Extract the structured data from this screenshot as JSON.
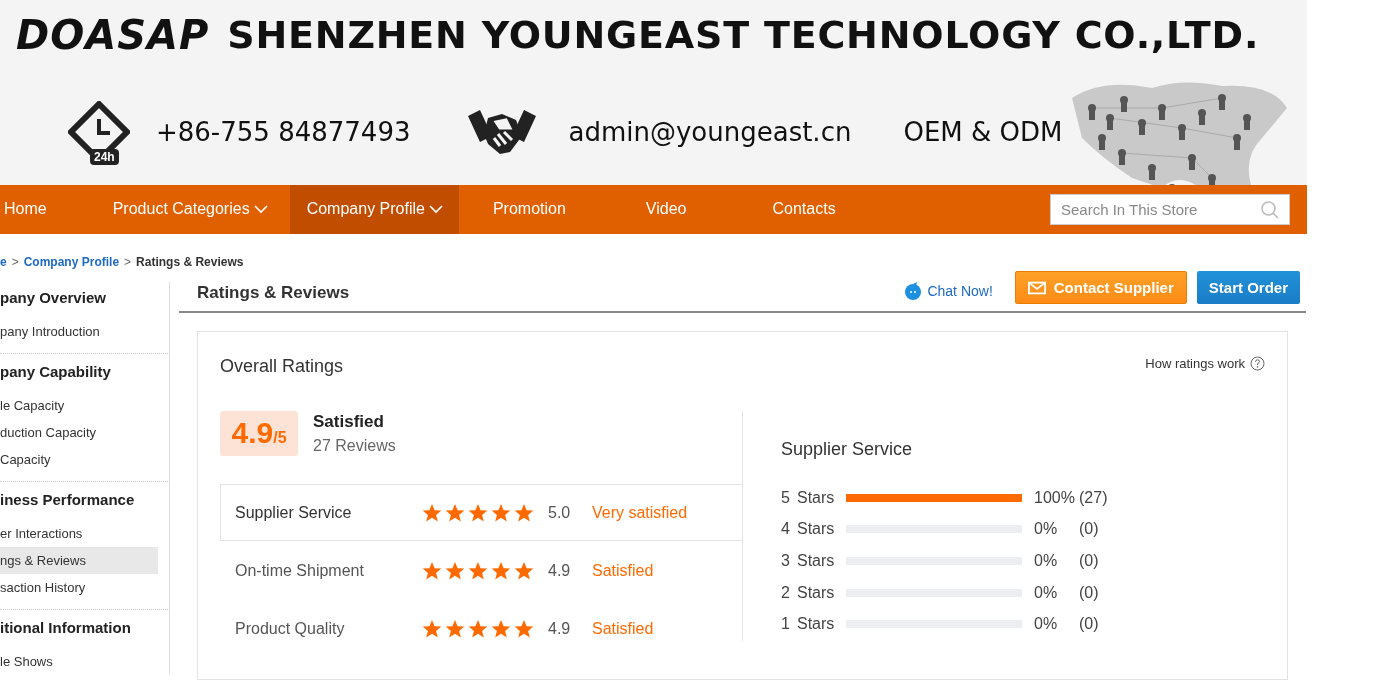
{
  "banner": {
    "logo": "DOASAP",
    "company_name": "SHENZHEN YOUNGEAST TECHNOLOGY CO.,LTD.",
    "clock_badge": "24h",
    "phone": "+86-755 84877493",
    "email": "admin@youngeast.cn",
    "tagline": "OEM & ODM"
  },
  "nav": {
    "items": [
      {
        "label": "Home",
        "dropdown": false,
        "selected": false
      },
      {
        "label": "Product Categories",
        "dropdown": true,
        "selected": false
      },
      {
        "label": "Company Profile",
        "dropdown": true,
        "selected": true
      },
      {
        "label": "Promotion",
        "dropdown": false,
        "selected": false
      },
      {
        "label": "Video",
        "dropdown": false,
        "selected": false
      },
      {
        "label": "Contacts",
        "dropdown": false,
        "selected": false
      }
    ],
    "search": {
      "placeholder": "Search In This Store"
    }
  },
  "breadcrumb": [
    {
      "label": "e",
      "kind": "link"
    },
    {
      "label": ">",
      "kind": "separator"
    },
    {
      "label": "Company Profile",
      "kind": "link"
    },
    {
      "label": ">",
      "kind": "separator"
    },
    {
      "label": "Ratings & Reviews",
      "kind": "current"
    }
  ],
  "sidebar": {
    "sections": [
      {
        "title": "pany Overview",
        "items": [
          {
            "label": "pany Introduction",
            "selected": false
          }
        ]
      },
      {
        "title": "pany Capability",
        "items": [
          {
            "label": "le Capacity",
            "selected": false
          },
          {
            "label": "duction Capacity",
            "selected": false
          },
          {
            "label": "Capacity",
            "selected": false
          }
        ]
      },
      {
        "title": "iness Performance",
        "items": [
          {
            "label": "er Interactions",
            "selected": false
          },
          {
            "label": "ngs & Reviews",
            "selected": true
          },
          {
            "label": "saction History",
            "selected": false
          }
        ]
      },
      {
        "title": "itional Information",
        "items": [
          {
            "label": "le Shows",
            "selected": false
          }
        ]
      }
    ]
  },
  "page_title": "Ratings & Reviews",
  "actions": {
    "chat": "Chat Now!",
    "contact": "Contact Supplier",
    "order": "Start Order"
  },
  "ratings": {
    "title": "Overall Ratings",
    "help": "How ratings work",
    "score": "4.9",
    "out_of": "/5",
    "verdict": "Satisfied",
    "reviews": "27 Reviews",
    "categories": [
      {
        "name": "Supplier Service",
        "stars": 5,
        "score": "5.0",
        "verdict": "Very satisfied",
        "selected": true
      },
      {
        "name": "On-time Shipment",
        "stars": 5,
        "score": "4.9",
        "verdict": "Satisfied",
        "selected": false
      },
      {
        "name": "Product Quality",
        "stars": 5,
        "score": "4.9",
        "verdict": "Satisfied",
        "selected": false
      }
    ],
    "breakdown": {
      "title": "Supplier Service",
      "rows": [
        {
          "stars_label": "5",
          "unit": "Stars",
          "level": 1,
          "percent": "100%",
          "count": "(27)"
        },
        {
          "stars_label": "4",
          "unit": "Stars",
          "level": 0,
          "percent": "0%",
          "count": "(0)"
        },
        {
          "stars_label": "3",
          "unit": "Stars",
          "level": 0,
          "percent": "0%",
          "count": "(0)"
        },
        {
          "stars_label": "2",
          "unit": "Stars",
          "level": 0,
          "percent": "0%",
          "count": "(0)"
        },
        {
          "stars_label": "1",
          "unit": "Stars",
          "level": 0,
          "percent": "0%",
          "count": "(0)"
        }
      ]
    }
  }
}
